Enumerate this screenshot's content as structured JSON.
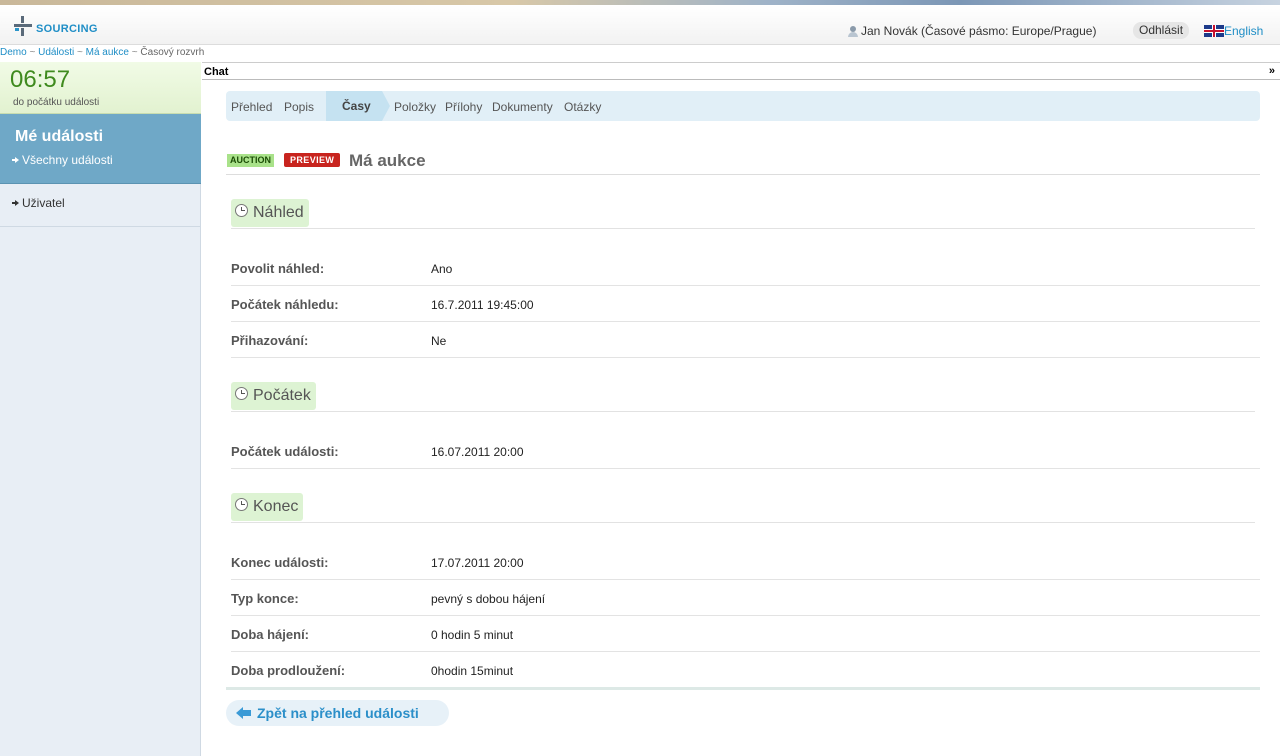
{
  "header": {
    "logo_text": "SOURCING",
    "user": "Jan Novák (Časové pásmo: Europe/Prague)",
    "logout_label": "Odhlásit",
    "language_label": "English"
  },
  "breadcrumb": {
    "items": [
      "Demo",
      "Události",
      "Má aukce",
      "Časový rozvrh"
    ],
    "separator": "~"
  },
  "sidebar": {
    "timer": {
      "time": "06:57",
      "label": "do počátku události"
    },
    "my_events": {
      "title": "Mé události",
      "link": "Všechny události"
    },
    "user_item": "Uživatel"
  },
  "chat": {
    "label": "Chat",
    "toggle": "»"
  },
  "tabs": {
    "items": [
      "Přehled",
      "Popis",
      "Časy",
      "Položky",
      "Přílohy",
      "Dokumenty",
      "Otázky"
    ],
    "active": "Časy"
  },
  "title": {
    "badge_auction": "AUCTION",
    "badge_preview": "PREVIEW",
    "text": "Má aukce"
  },
  "sections": {
    "nahled": {
      "label": "Náhled",
      "rows": [
        {
          "label": "Povolit náhled:",
          "value": "Ano"
        },
        {
          "label": "Počátek náhledu:",
          "value": "16.7.2011 19:45:00"
        },
        {
          "label": "Přihazování:",
          "value": "Ne"
        }
      ]
    },
    "pocatek": {
      "label": "Počátek",
      "rows": [
        {
          "label": "Počátek události:",
          "value": "16.07.2011 20:00"
        }
      ]
    },
    "konec": {
      "label": "Konec",
      "rows": [
        {
          "label": "Konec události:",
          "value": "17.07.2011 20:00"
        },
        {
          "label": "Typ konce:",
          "value": "pevný s dobou hájení"
        },
        {
          "label": "Doba hájení:",
          "value": "0 hodin 5 minut"
        },
        {
          "label": "Doba prodloužení:",
          "value": "0hodin 15minut"
        }
      ]
    }
  },
  "back_button": "Zpět na přehled události",
  "colors": {
    "accent": "#1f8ec6",
    "timer_green": "#3f8a1e",
    "sidebar_active": "#6fa8c7",
    "preview_badge": "#c8241e",
    "auction_badge": "#a9e28a",
    "section_pill": "#ddf3d3"
  }
}
